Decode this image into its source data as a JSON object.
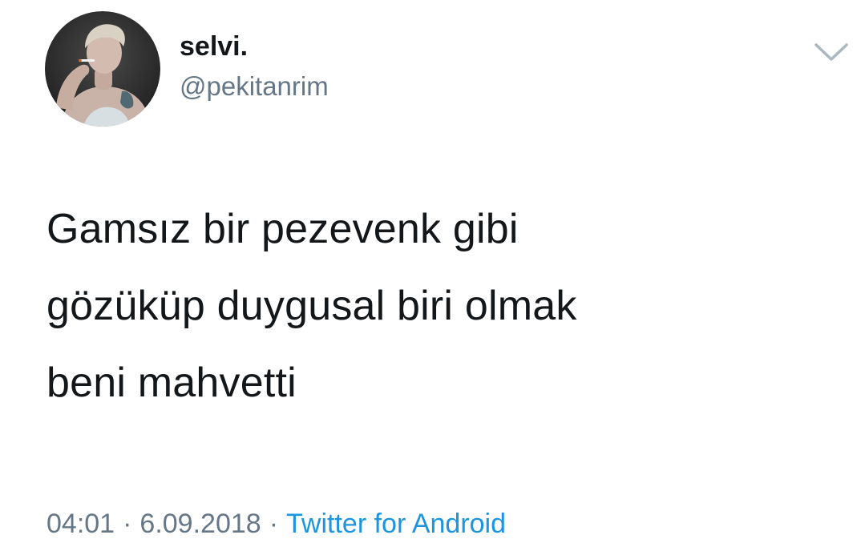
{
  "tweet": {
    "author": {
      "display_name": "selvi.",
      "handle": "@pekitanrim",
      "avatar_icon": "user-avatar-photo"
    },
    "menu_icon": "chevron-down-icon",
    "text": "Gamsız bir pezevenk gibi\ngözüküp duygusal biri olmak\nbeni mahvetti",
    "time": "04:01",
    "date": "6.09.2018",
    "separator": "·",
    "source": "Twitter for Android"
  },
  "colors": {
    "text": "#14171a",
    "muted": "#657786",
    "link": "#1b95e0",
    "chevron": "#aab8c2",
    "background": "#ffffff"
  }
}
